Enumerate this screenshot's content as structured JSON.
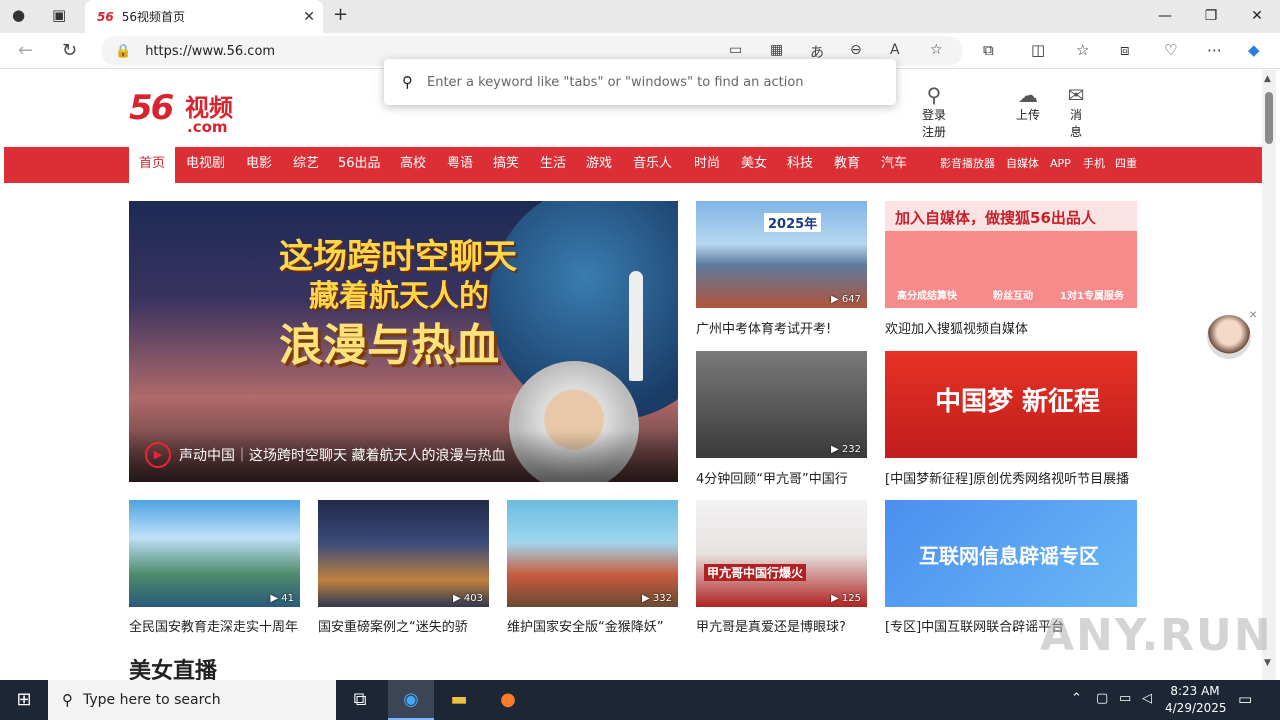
{
  "browser": {
    "tab_title": "56视频首页",
    "tab_favicon": "56",
    "url": "https://www.56.com",
    "command_placeholder": "Enter a keyword like \"tabs\" or \"windows\" to find an action"
  },
  "header": {
    "logo_num": "56",
    "logo_cn": "视频",
    "logo_com": ".com",
    "login": "登录",
    "register": "注册",
    "upload": "上传",
    "messages_line1": "消",
    "messages_line2": "息"
  },
  "nav": {
    "items": [
      "首页",
      "电视剧",
      "电影",
      "综艺",
      "56出品",
      "高校",
      "粤语",
      "搞笑",
      "生活",
      "游戏",
      "音乐人",
      "时尚",
      "美女",
      "科技",
      "教育",
      "汽车"
    ],
    "extra": [
      "影音播放器",
      "自媒体",
      "APP",
      "手机",
      "四重"
    ]
  },
  "hero": {
    "line1": "这场跨时空聊天",
    "line2": "藏着航天人的",
    "line3": "浪漫与热血",
    "caption": "声动中国｜这场跨时空聊天 藏着航天人的浪漫与热血"
  },
  "cards": [
    {
      "caption": "广州中考体育考试开考!",
      "count": "647",
      "overlay": "2025年"
    },
    {
      "caption": "欢迎加入搜狐视频自媒体",
      "count": "",
      "overlay": "加入自媒体，做搜狐56出品人",
      "sub": [
        "高分成结算快",
        "粉丝互动",
        "1对1专属服务"
      ]
    },
    {
      "caption": "4分钟回顾“甲亢哥”中国行",
      "count": "232",
      "overlay": ""
    },
    {
      "caption": "[中国梦新征程]原创优秀网络视听节目展播",
      "count": "",
      "overlay": "中国梦 新征程"
    },
    {
      "caption": "全民国安教育走深走实十周年",
      "count": "41",
      "overlay": ""
    },
    {
      "caption": "国安重磅案例之“迷失的骄",
      "count": "403",
      "overlay": ""
    },
    {
      "caption": "维护国家安全版“金猴降妖”",
      "count": "332",
      "overlay": ""
    },
    {
      "caption": "甲亢哥是真爱还是博眼球?",
      "count": "125",
      "overlay": "甲亢哥中国行爆火"
    },
    {
      "caption": "[专区]中国互联网联合辟谣平台",
      "count": "",
      "overlay": "互联网信息辟谣专区"
    }
  ],
  "section_title": "美女直播",
  "watermark": "ANY.RUN",
  "taskbar": {
    "search_placeholder": "Type here to search",
    "time": "8:23 AM",
    "date": "4/29/2025"
  },
  "colors": {
    "brand_red": "#dc2e35",
    "taskbar": "#1c2634"
  }
}
